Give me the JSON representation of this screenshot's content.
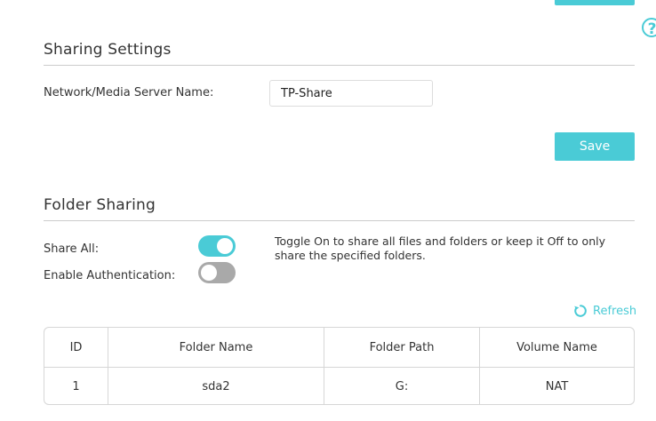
{
  "help": {
    "glyph": "?"
  },
  "sharing_settings": {
    "title": "Sharing Settings",
    "server_name_label": "Network/Media Server Name:",
    "server_name_value": "TP-Share",
    "save_label": "Save"
  },
  "folder_sharing": {
    "title": "Folder Sharing",
    "share_all_label": "Share All:",
    "share_all_on": true,
    "enable_auth_label": "Enable Authentication:",
    "enable_auth_on": false,
    "hint": "Toggle On to share all files and folders or keep it Off to only share the specified folders.",
    "refresh_label": "Refresh"
  },
  "table": {
    "headers": [
      "ID",
      "Folder Name",
      "Folder Path",
      "Volume Name"
    ],
    "rows": [
      [
        "1",
        "sda2",
        "G:",
        "NAT"
      ]
    ]
  },
  "colors": {
    "accent": "#4acbd6",
    "toggle_off": "#a9a9a9",
    "divider": "#cccccc"
  },
  "icons": {
    "help": "question-circle-icon",
    "refresh": "refresh-icon"
  }
}
